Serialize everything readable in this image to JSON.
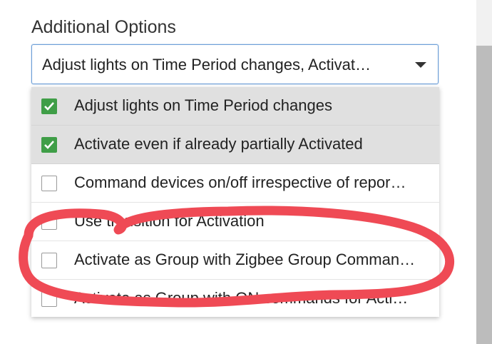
{
  "field": {
    "label": "Additional Options",
    "selected_value": "Adjust lights on Time Period changes, Activat…"
  },
  "options": [
    {
      "label": "Adjust lights on Time Period changes",
      "checked": true
    },
    {
      "label": "Activate even if already partially Activated",
      "checked": true
    },
    {
      "label": "Command devices on/off irrespective of repor…",
      "checked": false
    },
    {
      "label": "Use transition for Activation",
      "checked": false
    },
    {
      "label": "Activate as Group with Zigbee Group Comman…",
      "checked": false
    },
    {
      "label": "Activate as Group with ON commands for Acti…",
      "checked": false
    }
  ],
  "colors": {
    "check_accent": "#3f9e47",
    "select_border": "#6fa0d8",
    "annotation_stroke": "#ef4a55"
  },
  "icons": {
    "caret": "caret-down-icon",
    "checkmark": "checkmark-icon"
  }
}
